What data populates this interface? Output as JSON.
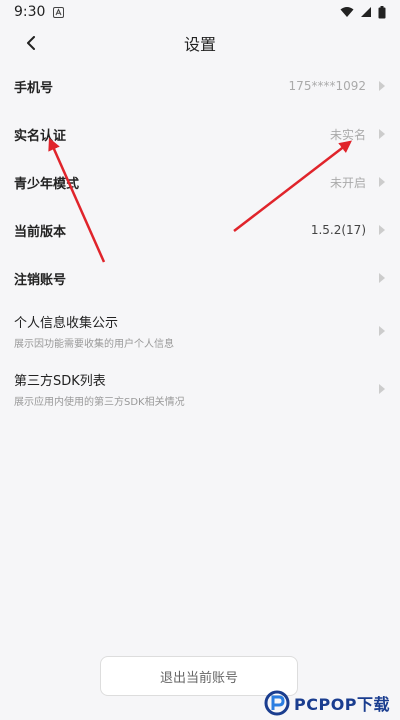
{
  "status_bar": {
    "time": "9:30"
  },
  "header": {
    "title": "设置"
  },
  "rows": [
    {
      "label": "手机号",
      "value": "175****1092"
    },
    {
      "label": "实名认证",
      "value": "未实名"
    },
    {
      "label": "青少年模式",
      "value": "未开启"
    },
    {
      "label": "当前版本",
      "value": "1.5.2(17)"
    },
    {
      "label": "注销账号"
    },
    {
      "label": "个人信息收集公示",
      "sub": "展示因功能需要收集的用户个人信息"
    },
    {
      "label": "第三方SDK列表",
      "sub": "展示应用内使用的第三方SDK相关情况"
    }
  ],
  "logout": {
    "label": "退出当前账号"
  },
  "watermark": {
    "text": "PCPOP下载"
  },
  "colors": {
    "arrow": "#e0242b",
    "background": "#f6f6f8",
    "watermark": "#1a3d8f"
  }
}
